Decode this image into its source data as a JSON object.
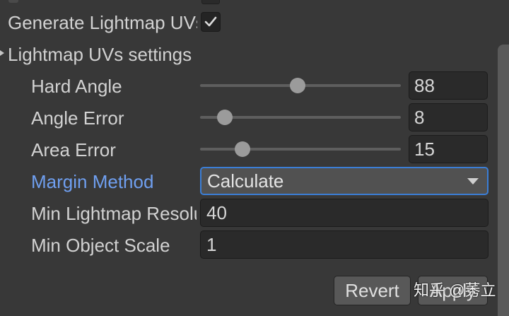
{
  "generate_lightmap": {
    "label": "Generate Lightmap UVs",
    "checked": true
  },
  "lightmap_section": {
    "title": "Lightmap UVs settings"
  },
  "sliders": [
    {
      "label": "Hard Angle",
      "value": "88"
    },
    {
      "label": "Angle Error",
      "value": "8"
    },
    {
      "label": "Area Error",
      "value": "15"
    }
  ],
  "margin_method": {
    "label": "Margin Method",
    "value": "Calculate"
  },
  "min_lightmap_resolution": {
    "label": "Min Lightmap Resolution",
    "value": "40"
  },
  "min_object_scale": {
    "label": "Min Object Scale",
    "value": "1"
  },
  "buttons": {
    "revert": "Revert",
    "apply": "Apply"
  },
  "watermark": "知乎 @莠立",
  "colors": {
    "panel_bg": "#383838",
    "text": "#d2d2d2",
    "active_label": "#6f9ff0",
    "focus_border": "#3b7ed6"
  }
}
